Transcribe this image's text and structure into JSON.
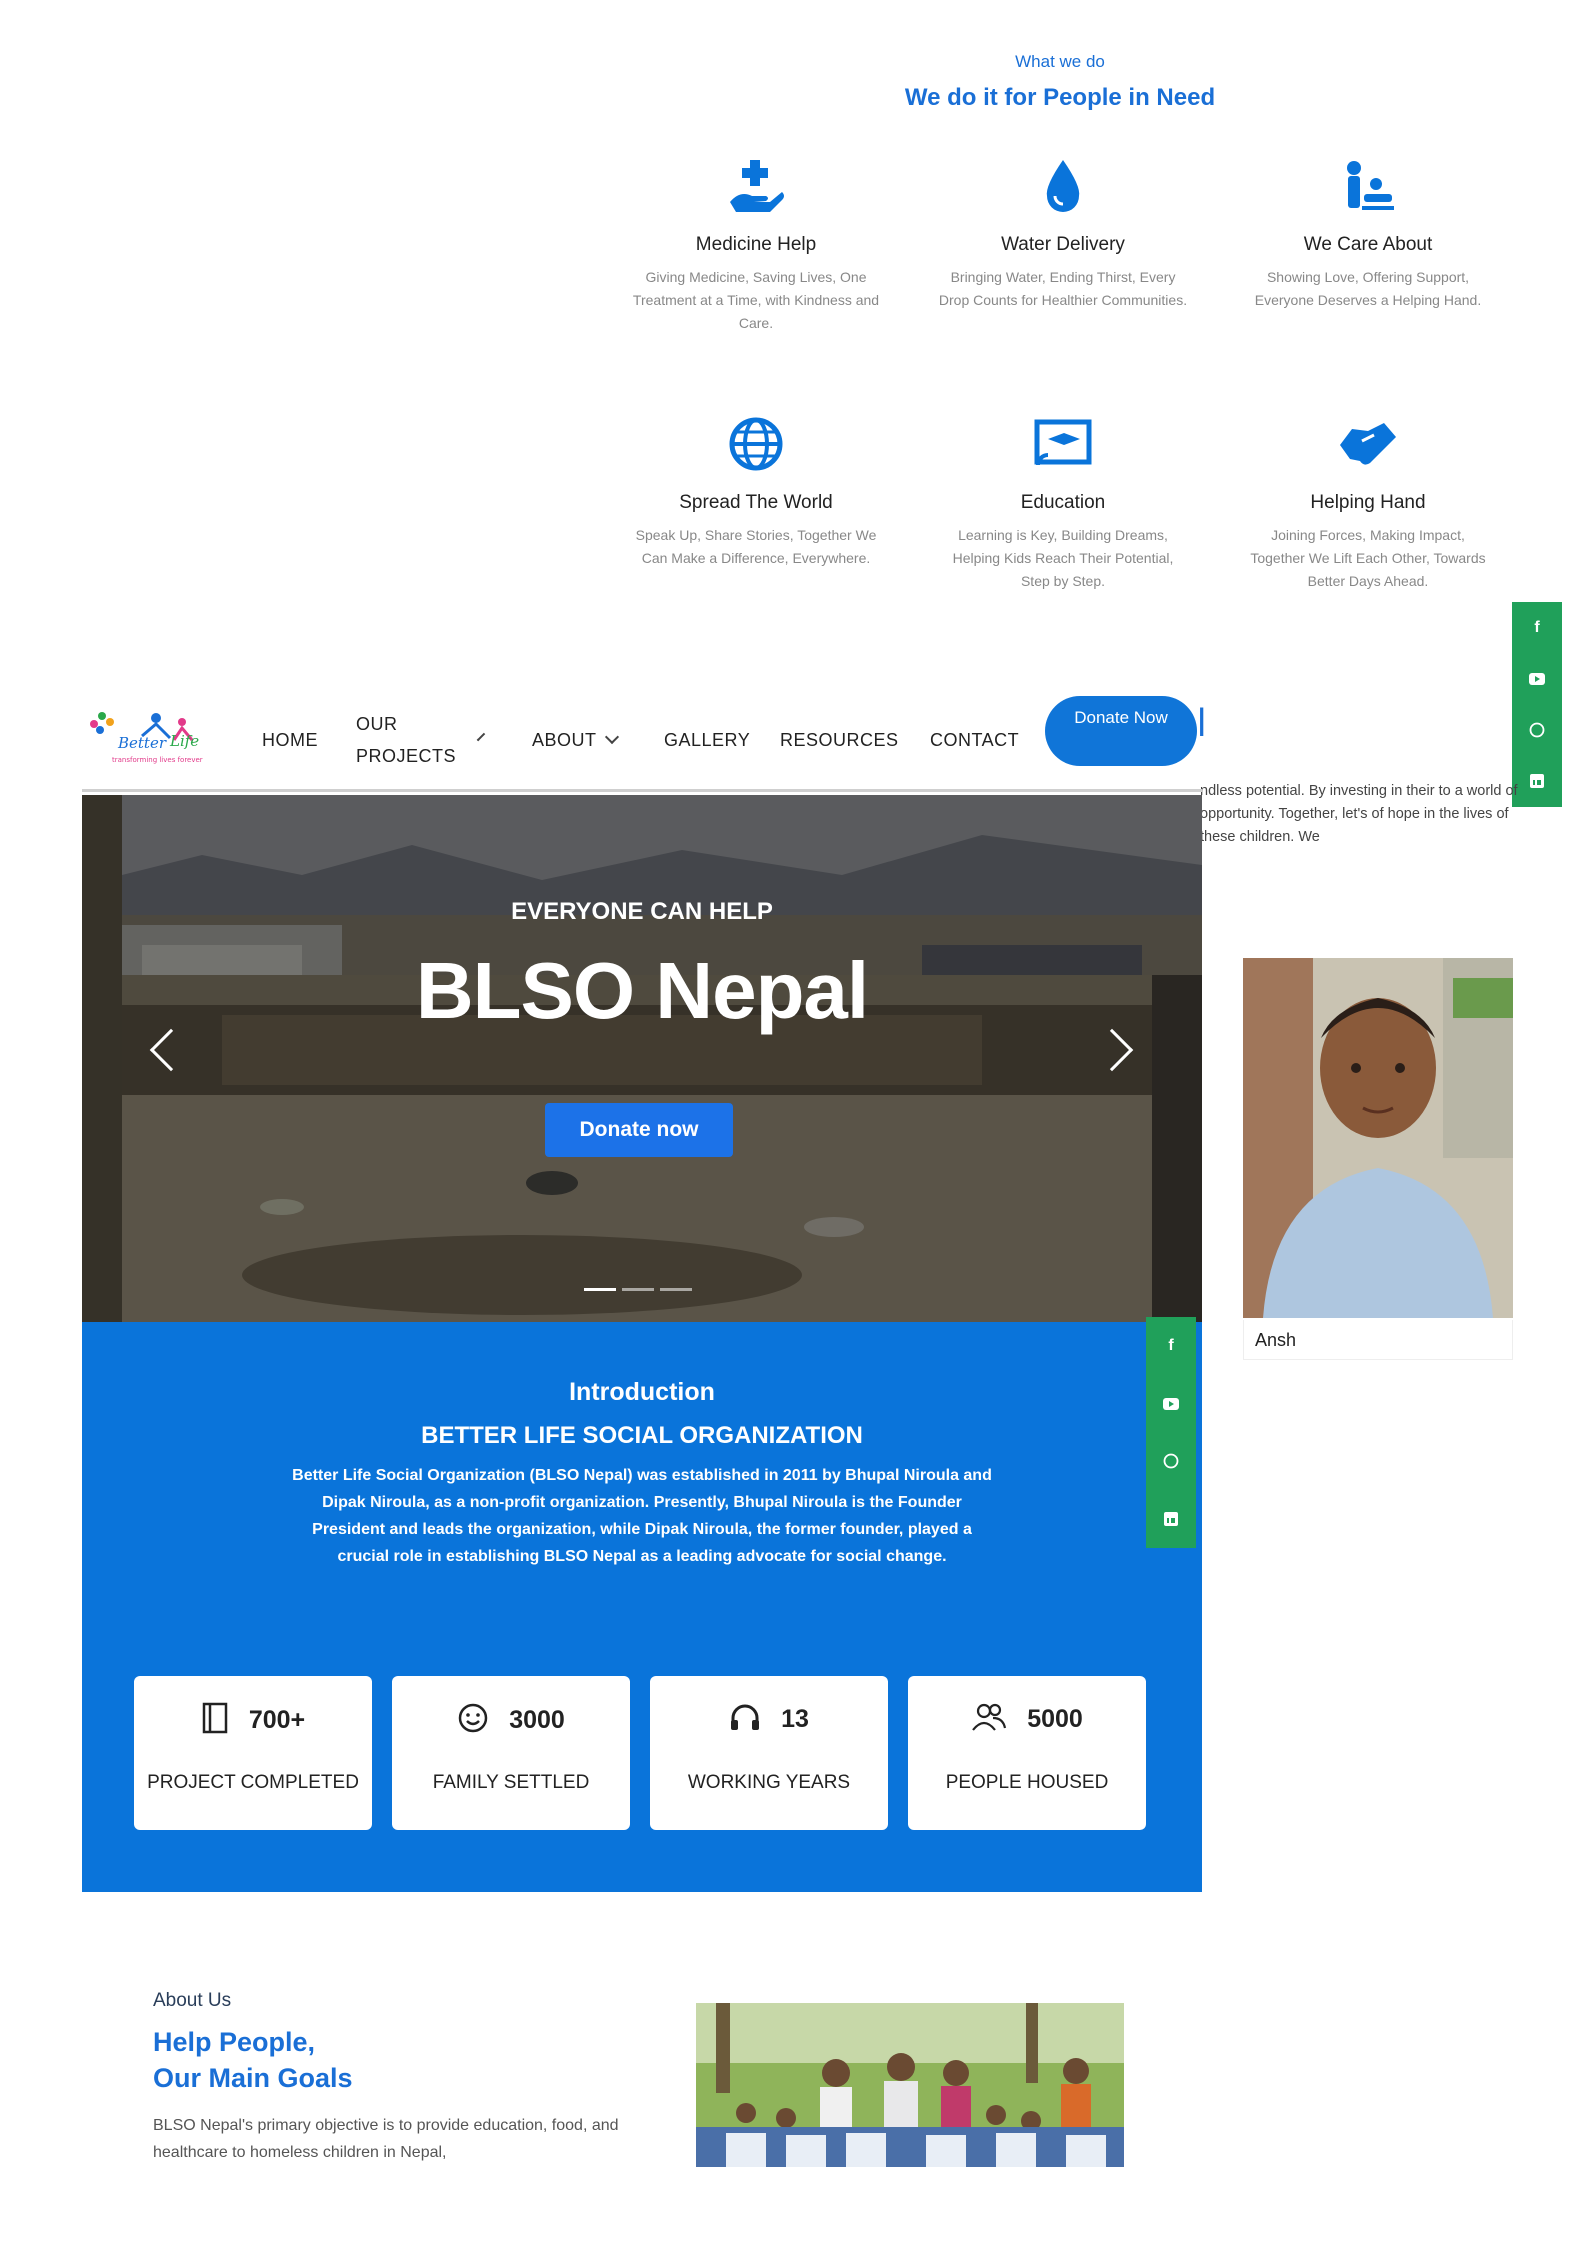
{
  "what_we_do": {
    "eyebrow": "What we do",
    "title": "We do it for People in Need",
    "services": [
      {
        "icon": "hand-medical-icon",
        "title": "Medicine Help",
        "desc": "Giving Medicine, Saving Lives, One Treatment at a Time, with Kindness and Care."
      },
      {
        "icon": "water-drop-icon",
        "title": "Water Delivery",
        "desc": "Bringing Water, Ending Thirst, Every Drop Counts for Healthier Communities."
      },
      {
        "icon": "baby-care-icon",
        "title": "We Care About",
        "desc": "Showing Love, Offering Support, Everyone Deserves a Helping Hand."
      },
      {
        "icon": "globe-icon",
        "title": "Spread The World",
        "desc": "Speak Up, Share Stories, Together We Can Make a Difference, Everywhere."
      },
      {
        "icon": "online-education-icon",
        "title": "Education",
        "desc": "Learning is Key, Building Dreams, Helping Kids Reach Their Potential, Step by Step."
      },
      {
        "icon": "handshake-icon",
        "title": "Helping Hand",
        "desc": "Joining Forces, Making Impact, Together We Lift Each Other, Towards Better Days Ahead."
      }
    ]
  },
  "nav": {
    "items": [
      "HOME",
      "OUR PROJECTS",
      "ABOUT",
      "GALLERY",
      "RESOURCES",
      "CONTACT"
    ],
    "donate": "Donate Now"
  },
  "side_text": "ndless potential. By investing in their to a world of opportunity. Together, let's of hope in the lives of these children. We",
  "hero": {
    "eyebrow": "EVERYONE CAN HELP",
    "title": "BLSO Nepal",
    "button": "Donate now"
  },
  "intro": {
    "heading": "Introduction",
    "subheading": "BETTER LIFE SOCIAL ORGANIZATION",
    "text": "Better Life Social Organization (BLSO Nepal) was established in 2011 by Bhupal Niroula and Dipak Niroula, as a non-profit organization. Presently, Bhupal Niroula is the Founder President and leads the organization, while Dipak Niroula, the former founder, played a crucial role in establishing BLSO Nepal as a leading advocate for social change.",
    "stats": [
      {
        "icon": "notebook-icon",
        "value": "700+",
        "label": "PROJECT COMPLETED"
      },
      {
        "icon": "smiley-icon",
        "value": "3000",
        "label": "FAMILY SETTLED"
      },
      {
        "icon": "headphones-icon",
        "value": "13",
        "label": "WORKING YEARS"
      },
      {
        "icon": "people-icon",
        "value": "5000",
        "label": "PEOPLE HOUSED"
      }
    ]
  },
  "child_card": {
    "name": "Ansh"
  },
  "about": {
    "eyebrow": "About Us",
    "title_line1": "Help People,",
    "title_line2": "Our Main Goals",
    "text": "BLSO Nepal's primary objective is to provide education, food, and healthcare to homeless children in Nepal,"
  },
  "colors": {
    "primary": "#0a74da",
    "accent_green": "#20a05a",
    "title_blue": "#1a6fd6"
  }
}
